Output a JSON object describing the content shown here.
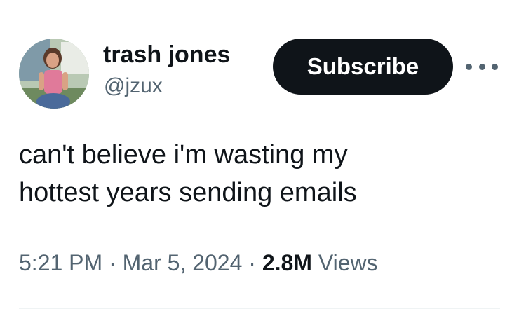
{
  "author": {
    "display_name": "trash jones",
    "handle": "@jzux",
    "avatar_icon": "profile-photo"
  },
  "actions": {
    "subscribe_label": "Subscribe",
    "more_icon": "more-horizontal-icon"
  },
  "tweet": {
    "text_lines": [
      "can't believe i'm wasting my",
      "hottest years sending emails"
    ]
  },
  "meta": {
    "time": "5:21 PM",
    "separator": "·",
    "date": "Mar 5, 2024",
    "views_count": "2.8M",
    "views_label": "Views"
  },
  "colors": {
    "text_primary": "#0f1419",
    "text_secondary": "#536471",
    "button_bg": "#0f1419",
    "button_text": "#ffffff",
    "divider": "#eff3f4"
  }
}
